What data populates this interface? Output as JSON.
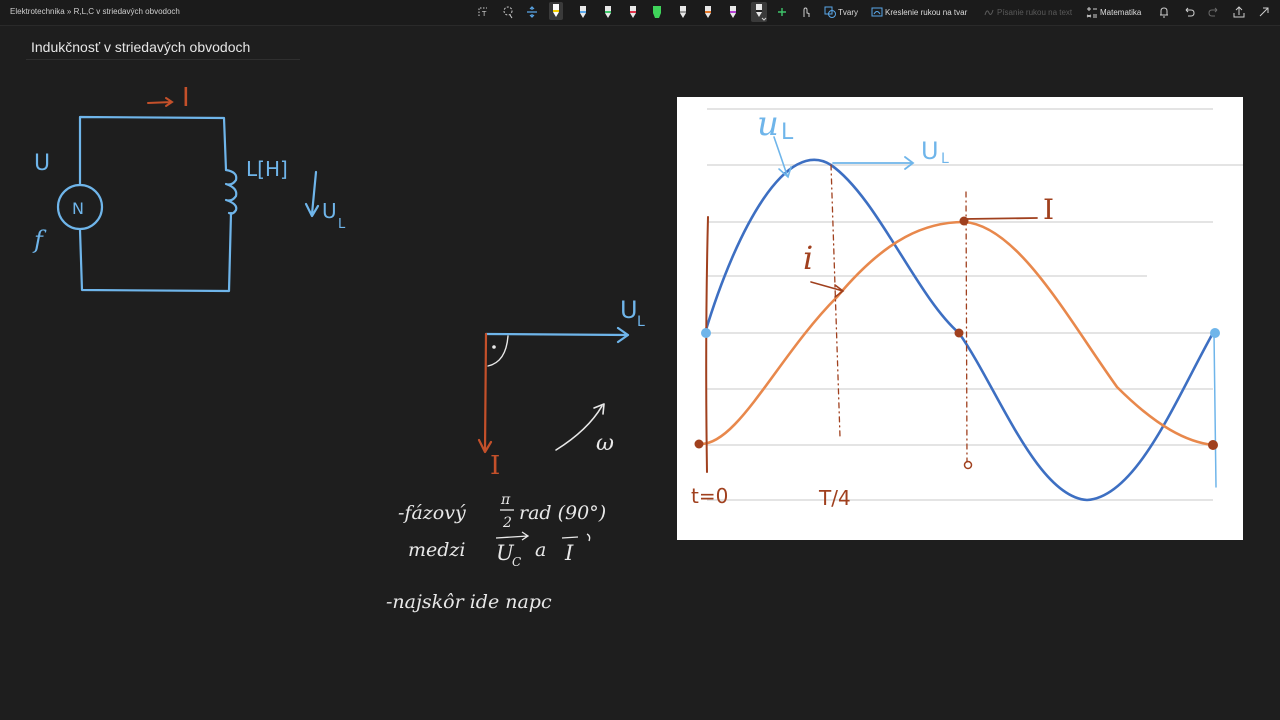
{
  "breadcrumb": "Elektrotechnika » R,L,C v striedavých obvodoch",
  "toolbar": {
    "shapes_label": "Tvary",
    "ink_to_shape_label": "Kreslenie rukou na tvar",
    "ink_to_text_label": "Písanie rukou na text",
    "math_label": "Matematika",
    "pens": [
      {
        "color": "#ffffff"
      },
      {
        "color": "#f5d000"
      },
      {
        "color": "#5aa7e8"
      },
      {
        "color": "#3ec46a"
      },
      {
        "color": "#e0334b"
      },
      {
        "color": "#3fd45a"
      },
      {
        "color": "#dddddd"
      },
      {
        "color": "#e2772b"
      },
      {
        "color": "#b23fd1"
      },
      {
        "color": "#222222"
      }
    ]
  },
  "page_title": "Indukčnosť v striedavých obvodoch",
  "circuit": {
    "current_label": "I",
    "voltage_label": "U",
    "frequency_label": "f",
    "source_label": "N",
    "inductance_label": "L[H]",
    "inductor_voltage_label": "U",
    "inductor_voltage_sub": "L"
  },
  "phasor": {
    "voltage_label": "U",
    "voltage_sub": "L",
    "current_label": "I",
    "omega_label": "ω"
  },
  "notes": {
    "line1": "-fázový",
    "pi_num": "π",
    "pi_den": "2",
    "line1_rest": "rad (90°)",
    "line2": "medzi",
    "uc": "U",
    "uc_sub": "C",
    "line2_a": "a",
    "line2_i": "I",
    "line3": "-najskôr ide napc"
  },
  "graph": {
    "label_uL": "u",
    "label_uL_sub": "L",
    "label_UL": "U",
    "label_UL_sub": "L",
    "label_I": "I",
    "label_i": "i",
    "label_t0": "t=0",
    "label_T4": "T/4"
  },
  "colors": {
    "background": "#1e1e1e",
    "circuit_blue": "#6fb5ea",
    "ink_orange": "#c4502a",
    "voltage_wave": "#3d6fc2",
    "current_wave": "#e8884c"
  }
}
